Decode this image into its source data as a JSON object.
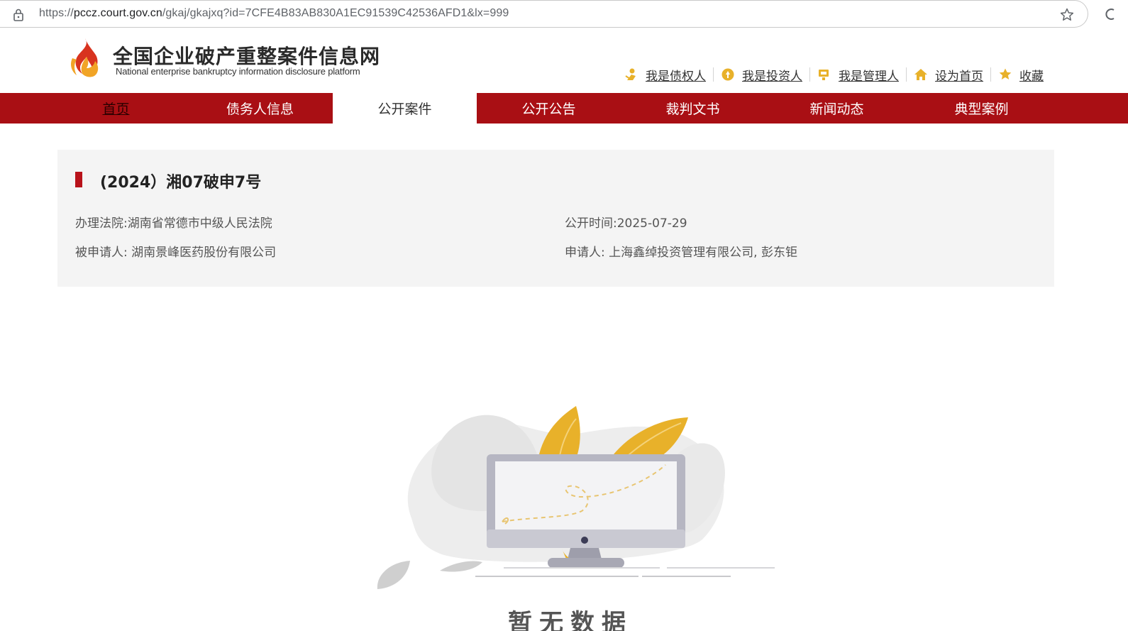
{
  "browser": {
    "url_prefix": "https://",
    "url_host": "pccz.court.gov.cn",
    "url_path": "/gkaj/gkajxq?id=7CFE4B83AB830A1EC91539C42536AFD1&lx=999",
    "icons": [
      "lock-icon",
      "star-icon"
    ]
  },
  "header": {
    "site_title": "全国企业破产重整案件信息网",
    "site_subtitle": "National enterprise bankruptcy  information disclosure platform",
    "quick_links": [
      {
        "label": "我是债权人",
        "icon": "creditor-icon"
      },
      {
        "label": "我是投资人",
        "icon": "investor-icon"
      },
      {
        "label": "我是管理人",
        "icon": "administrator-icon"
      },
      {
        "label": "设为首页",
        "icon": "home-icon"
      },
      {
        "label": "收藏",
        "icon": "star-icon"
      }
    ]
  },
  "nav": {
    "items": [
      {
        "label": "首页"
      },
      {
        "label": "债务人信息"
      },
      {
        "label": "公开案件"
      },
      {
        "label": "公开公告"
      },
      {
        "label": "裁判文书"
      },
      {
        "label": "新闻动态"
      },
      {
        "label": "典型案例"
      }
    ],
    "active_index": 2
  },
  "case": {
    "title": "(2024）湘07破申7号",
    "court_label": "办理法院:",
    "court_value": "湖南省常德市中级人民法院",
    "publish_label": "公开时间:",
    "publish_value": "2025-07-29",
    "respondent_label": "被申请人:",
    "respondent_value": "湖南景峰医药股份有限公司",
    "applicant_label": "申请人:",
    "applicant_value": "上海鑫绰投资管理有限公司, 彭东钜"
  },
  "empty_state": {
    "text": "暂无数据"
  },
  "colors": {
    "brand_red": "#a90f14",
    "marker_red": "#b8121a",
    "panel_bg": "#f4f4f4",
    "accent_gold": "#e8b12a"
  }
}
